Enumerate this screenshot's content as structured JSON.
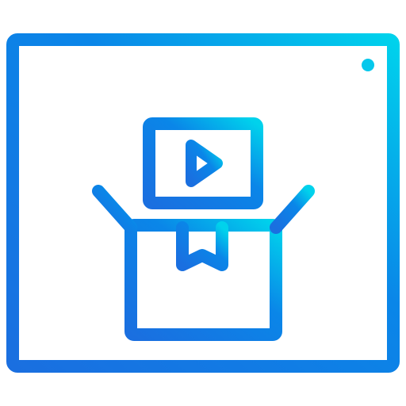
{
  "icon": {
    "name": "browser-unboxing-video-icon",
    "colors": {
      "gradient_start": "#1a6fe0",
      "gradient_mid": "#0a86e8",
      "gradient_end": "#00d2ec"
    },
    "parts": [
      "browser-window-icon",
      "address-bar-icon",
      "status-dot-icon",
      "video-screen-icon",
      "play-icon",
      "open-box-icon",
      "box-tape-icon",
      "box-label-lines-icon"
    ]
  }
}
